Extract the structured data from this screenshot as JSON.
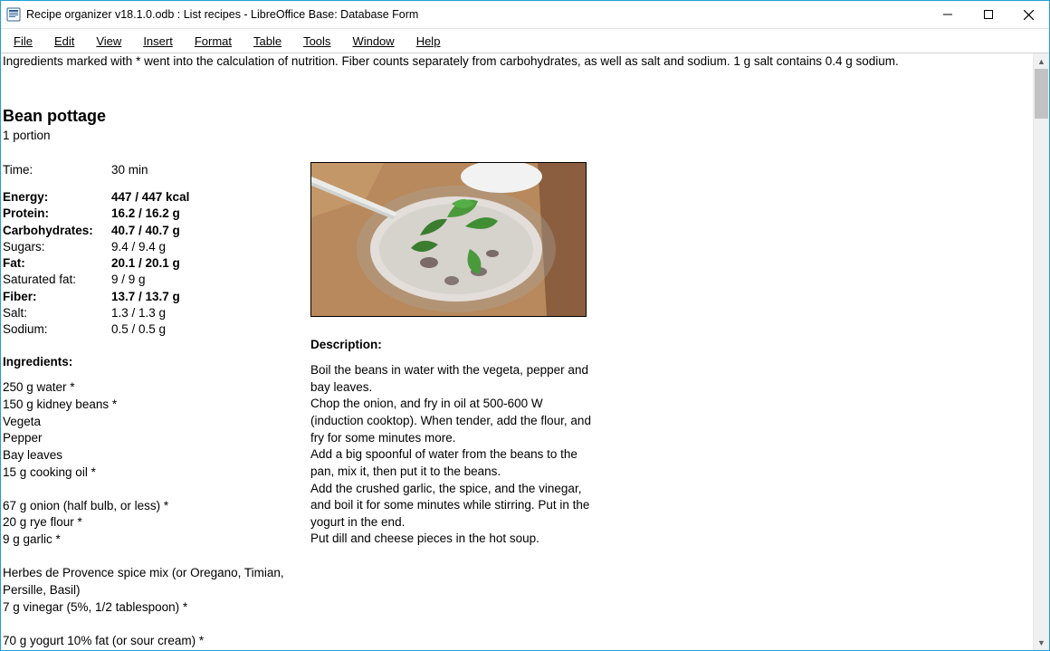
{
  "window": {
    "title": "Recipe organizer v18.1.0.odb : List recipes - LibreOffice Base: Database Form"
  },
  "menu": {
    "file": "File",
    "edit": "Edit",
    "view": "View",
    "insert": "Insert",
    "format": "Format",
    "table": "Table",
    "tools": "Tools",
    "window": "Window",
    "help": "Help"
  },
  "note": "Ingredients marked with * went into the calculation of nutrition. Fiber counts separately from carbohydrates, as well as salt and sodium. 1 g salt contains 0.4 g sodium.",
  "recipe": {
    "title": "Bean pottage",
    "portion": "1 portion",
    "time_label": "Time:",
    "time_value": "30 min",
    "nutrition": [
      {
        "label": "Energy:",
        "value": "447 / 447 kcal",
        "bold": true
      },
      {
        "label": "Protein:",
        "value": "16.2 / 16.2 g",
        "bold": true
      },
      {
        "label": "Carbohydrates:",
        "value": "40.7 / 40.7 g",
        "bold": true
      },
      {
        "label": "Sugars:",
        "value": "9.4 / 9.4 g",
        "bold": false
      },
      {
        "label": "Fat:",
        "value": "20.1 / 20.1 g",
        "bold": true
      },
      {
        "label": "Saturated fat:",
        "value": "9 / 9 g",
        "bold": false
      },
      {
        "label": "Fiber:",
        "value": "13.7 / 13.7 g",
        "bold": true
      },
      {
        "label": "Salt:",
        "value": "1.3 / 1.3 g",
        "bold": false
      },
      {
        "label": "Sodium:",
        "value": "0.5 / 0.5 g",
        "bold": false
      }
    ],
    "ingredients_heading": "Ingredients:",
    "ingredients": [
      "250 g water *",
      "150 g kidney beans *",
      "Vegeta",
      "Pepper",
      "Bay leaves",
      "15 g cooking oil *",
      "",
      "67 g onion (half bulb, or less) *",
      "20 g rye flour *",
      "9 g garlic *",
      "",
      "Herbes de Provence spice mix (or Oregano, Timian, Persille, Basil)",
      "7 g vinegar (5%, 1/2 tablespoon) *",
      "",
      "70 g yogurt 10% fat (or sour cream) *"
    ],
    "description_heading": "Description:",
    "description": [
      "Boil the beans in water with the vegeta, pepper and bay leaves.",
      "Chop the onion, and fry in oil at 500-600 W (induction cooktop). When tender, add the flour, and fry for some minutes more.",
      "Add a big spoonful of water from the beans to the pan, mix it, then put it to the beans.",
      "Add the crushed garlic, the spice, and the vinegar, and boil it for some minutes while stirring. Put in the yogurt in the end.",
      "Put dill and cheese pieces in the hot soup."
    ]
  }
}
